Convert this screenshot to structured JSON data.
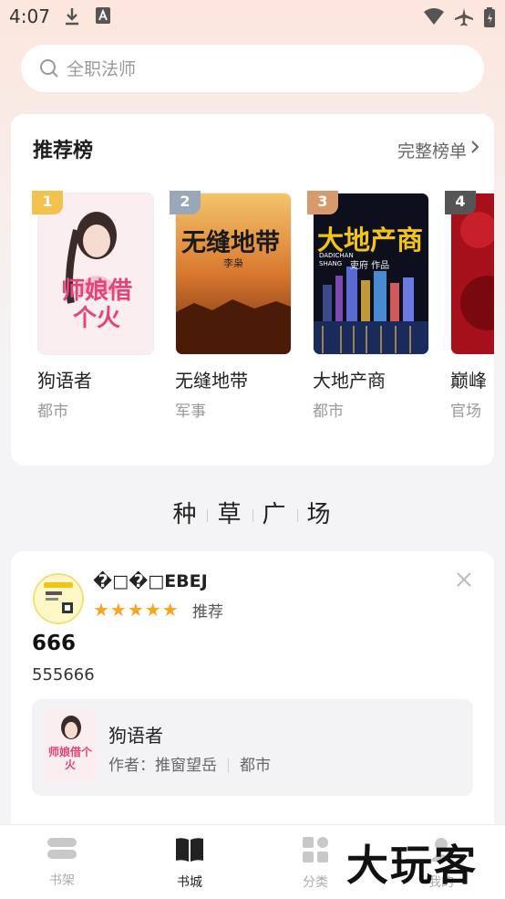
{
  "status_bar": {
    "time": "4:07"
  },
  "search": {
    "placeholder": "全职法师"
  },
  "ranking": {
    "title": "推荐榜",
    "more_label": "完整榜单",
    "books": [
      {
        "rank": "1",
        "title": "狗语者",
        "category": "都市",
        "rank_color": "#f2c14e",
        "cover_text": "师娘借个火"
      },
      {
        "rank": "2",
        "title": "无缝地带",
        "category": "军事",
        "rank_color": "#9aa7b8",
        "cover_text": "无缝地带",
        "cover_author": "李枭"
      },
      {
        "rank": "3",
        "title": "大地产商",
        "category": "都市",
        "rank_color": "#d89a6a",
        "cover_text": "大地产商",
        "cover_sub": "DADICHAN SHANG",
        "cover_author": "吏府 作品"
      },
      {
        "rank": "4",
        "title": "巅峰",
        "category": "官场",
        "rank_color": "#555555"
      }
    ]
  },
  "plaza": {
    "chars": [
      "种",
      "草",
      "广",
      "场"
    ]
  },
  "post": {
    "username": "�□�□EBEJ",
    "stars": "★★★★★",
    "recommend_label": "推荐",
    "title": "666",
    "body": "555666",
    "book": {
      "title": "狗语者",
      "author_label": "作者：推窗望岳",
      "category": "都市",
      "cover_text": "师娘借个火"
    }
  },
  "tabs": [
    {
      "label": "书架",
      "icon": "bookshelf-icon"
    },
    {
      "label": "书城",
      "icon": "open-book-icon",
      "active": true
    },
    {
      "label": "分类",
      "icon": "grid-icon"
    },
    {
      "label": "我的",
      "icon": "profile-icon"
    }
  ],
  "watermark": "大玩客"
}
